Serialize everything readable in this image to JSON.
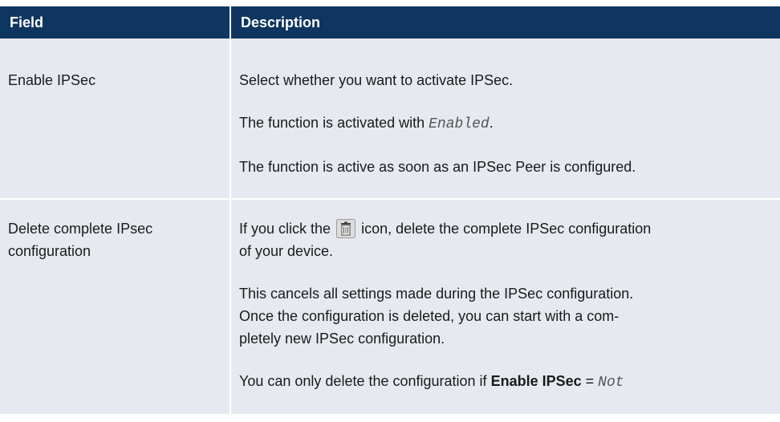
{
  "table": {
    "header": {
      "field": "Field",
      "description": "Description"
    },
    "rows": [
      {
        "field": "Enable IPSec",
        "paragraphs": {
          "p1": "Select whether you want to activate IPSec.",
          "p2_pre": "The function is activated with ",
          "p2_code": "Enabled",
          "p2_post": ".",
          "p3": "The function is active as soon as an IPSec Peer is configured."
        }
      },
      {
        "field_line1": "Delete complete IPsec",
        "field_line2": "configuration",
        "paragraphs": {
          "p1_pre": "If you click the ",
          "p1_post": " icon, delete the complete IPSec configuration",
          "p1_line2": "of your device.",
          "p2_line1": "This cancels all settings made during the IPSec configuration.",
          "p2_line2": "Once the configuration is deleted, you can start with a com-",
          "p2_line3": "pletely new IPSec configuration.",
          "p3_pre": "You can only delete the configuration if ",
          "p3_bold": "Enable IPSec",
          "p3_eq": " = ",
          "p3_code": "Not"
        }
      }
    ]
  },
  "icons": {
    "trash": "trash-icon"
  },
  "colors": {
    "header_bg": "#0e3660",
    "cell_bg": "#e6eaf0"
  }
}
